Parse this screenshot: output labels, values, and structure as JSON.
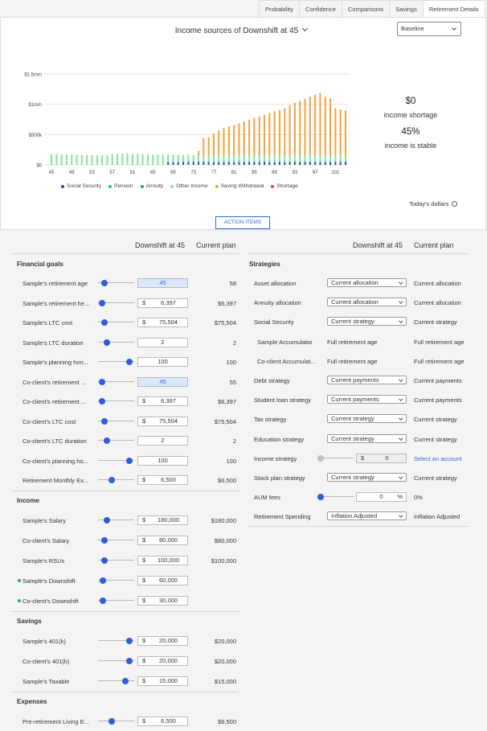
{
  "tabs": [
    "Probability",
    "Confidence",
    "Comparisons",
    "Savings",
    "Retirement Details"
  ],
  "chart": {
    "title": "Income sources of Downshift at 45",
    "scenario_select": "Baseline",
    "shortage_value": "$0",
    "shortage_label": "income shortage",
    "stable_value": "45%",
    "stable_label": "income is stable",
    "todays_dollars": "Today's dollars",
    "action_items": "ACTION ITEMS"
  },
  "chart_data": {
    "type": "bar",
    "stacked": true,
    "y_tick_labels": [
      "$0",
      "$500k",
      "$1mm",
      "$1.5mm"
    ],
    "ylim": [
      0,
      1500000
    ],
    "x_tick_labels": [
      "45",
      "49",
      "53",
      "57",
      "61",
      "65",
      "69",
      "73",
      "77",
      "81",
      "85",
      "89",
      "93",
      "97",
      "101"
    ],
    "x": [
      45,
      46,
      47,
      48,
      49,
      50,
      51,
      52,
      53,
      54,
      55,
      56,
      57,
      58,
      59,
      60,
      61,
      62,
      63,
      64,
      65,
      66,
      67,
      68,
      69,
      70,
      71,
      72,
      73,
      74,
      75,
      76,
      77,
      78,
      79,
      80,
      81,
      82,
      83,
      84,
      85,
      86,
      87,
      88,
      89,
      90,
      91,
      92,
      93,
      94,
      95,
      96,
      97,
      98,
      99,
      100,
      101,
      102,
      103
    ],
    "series": [
      {
        "name": "Social Security",
        "color": "#3b3fa8",
        "values": [
          0,
          0,
          0,
          0,
          0,
          0,
          0,
          0,
          0,
          0,
          0,
          0,
          0,
          0,
          0,
          0,
          0,
          0,
          0,
          0,
          0,
          0,
          0,
          40000,
          40000,
          40000,
          40000,
          40000,
          40000,
          40000,
          40000,
          40000,
          40000,
          40000,
          40000,
          40000,
          40000,
          40000,
          40000,
          40000,
          40000,
          40000,
          40000,
          40000,
          40000,
          40000,
          40000,
          40000,
          40000,
          40000,
          40000,
          40000,
          40000,
          40000,
          40000,
          40000,
          40000,
          40000,
          40000
        ]
      },
      {
        "name": "Pension",
        "color": "#26b5c9",
        "values": [
          0,
          0,
          0,
          0,
          0,
          0,
          0,
          0,
          0,
          0,
          0,
          0,
          0,
          0,
          0,
          0,
          0,
          0,
          0,
          0,
          0,
          0,
          0,
          20000,
          20000,
          20000,
          20000,
          20000,
          20000,
          20000,
          20000,
          20000,
          20000,
          20000,
          20000,
          20000,
          20000,
          20000,
          20000,
          20000,
          20000,
          20000,
          20000,
          20000,
          20000,
          20000,
          20000,
          20000,
          20000,
          20000,
          20000,
          20000,
          20000,
          20000,
          20000,
          20000,
          20000,
          20000,
          20000
        ]
      },
      {
        "name": "Annuity",
        "color": "#1ea58a",
        "values": [
          0,
          0,
          0,
          0,
          0,
          0,
          0,
          0,
          0,
          0,
          0,
          0,
          0,
          0,
          0,
          0,
          0,
          0,
          0,
          0,
          0,
          0,
          0,
          0,
          0,
          0,
          0,
          0,
          0,
          0,
          0,
          0,
          0,
          0,
          0,
          0,
          0,
          0,
          0,
          0,
          0,
          0,
          0,
          0,
          0,
          0,
          0,
          0,
          0,
          0,
          0,
          0,
          0,
          0,
          0,
          0,
          0,
          0,
          0
        ]
      },
      {
        "name": "Other Income",
        "color": "#86e39a",
        "values": [
          180000,
          180000,
          170000,
          170000,
          170000,
          165000,
          165000,
          160000,
          160000,
          160000,
          160000,
          160000,
          180000,
          180000,
          190000,
          190000,
          180000,
          180000,
          175000,
          175000,
          170000,
          170000,
          170000,
          110000,
          110000,
          110000,
          105000,
          105000,
          100000,
          100000,
          95000,
          95000,
          95000,
          95000,
          95000,
          95000,
          95000,
          95000,
          95000,
          95000,
          95000,
          95000,
          95000,
          95000,
          95000,
          95000,
          95000,
          95000,
          95000,
          95000,
          95000,
          95000,
          95000,
          95000,
          95000,
          95000,
          95000,
          95000,
          95000
        ]
      },
      {
        "name": "Saving Withdrawal",
        "color": "#f5a13c",
        "values": [
          0,
          0,
          0,
          0,
          0,
          0,
          0,
          0,
          0,
          0,
          0,
          0,
          0,
          0,
          0,
          0,
          0,
          0,
          0,
          0,
          0,
          0,
          0,
          0,
          0,
          0,
          0,
          0,
          0,
          70000,
          290000,
          300000,
          360000,
          410000,
          450000,
          480000,
          500000,
          530000,
          560000,
          590000,
          620000,
          640000,
          670000,
          700000,
          730000,
          750000,
          780000,
          830000,
          870000,
          900000,
          930000,
          970000,
          1000000,
          1030000,
          970000,
          940000,
          780000,
          760000,
          740000
        ]
      },
      {
        "name": "Shortage",
        "color": "#e0474c",
        "values": [
          0,
          0,
          0,
          0,
          0,
          0,
          0,
          0,
          0,
          0,
          0,
          0,
          0,
          0,
          0,
          0,
          0,
          0,
          0,
          0,
          0,
          0,
          0,
          0,
          0,
          0,
          0,
          0,
          0,
          0,
          0,
          0,
          0,
          0,
          0,
          0,
          0,
          0,
          0,
          0,
          0,
          0,
          0,
          0,
          0,
          0,
          0,
          0,
          0,
          0,
          0,
          0,
          0,
          0,
          0,
          0,
          0,
          0,
          0
        ]
      }
    ]
  },
  "columns": {
    "scenario": "Downshift at 45",
    "current": "Current plan"
  },
  "left": {
    "financial_goals": {
      "title": "Financial goals",
      "rows": [
        {
          "label": "Sample's retirement age",
          "value": "45",
          "current": "58"
        },
        {
          "label": "Sample's retirement he...",
          "prefix": "$",
          "value": "6,397",
          "current": "$6,397"
        },
        {
          "label": "Sample's LTC cost",
          "prefix": "$",
          "value": "75,504",
          "current": "$75,504"
        },
        {
          "label": "Sample's LTC duration",
          "value": "2",
          "current": "2"
        },
        {
          "label": "Sample's planning hori...",
          "value": "100",
          "current": "100"
        },
        {
          "label": "Co-client's retirement ...",
          "value": "45",
          "current": "55"
        },
        {
          "label": "Co-client's retirement ...",
          "prefix": "$",
          "value": "6,397",
          "current": "$6,397"
        },
        {
          "label": "Co-client's LTC cost",
          "prefix": "$",
          "value": "75,504",
          "current": "$75,504"
        },
        {
          "label": "Co-client's LTC duration",
          "value": "2",
          "current": "2"
        },
        {
          "label": "Co-client's planning ho...",
          "value": "100",
          "current": "100"
        },
        {
          "label": "Retirement Monthly Ex...",
          "prefix": "$",
          "value": "6,500",
          "current": "$6,500"
        }
      ]
    },
    "income": {
      "title": "Income",
      "rows": [
        {
          "label": "Sample's Salary",
          "prefix": "$",
          "value": "180,000",
          "current": "$180,000"
        },
        {
          "label": "Co-client's Salary",
          "prefix": "$",
          "value": "80,000",
          "current": "$80,000"
        },
        {
          "label": "Sample's RSUs",
          "prefix": "$",
          "value": "100,000",
          "current": "$100,000"
        },
        {
          "label": "Sample's Downshift",
          "prefix": "$",
          "value": "60,000",
          "current": ""
        },
        {
          "label": "Co-client's Downshift",
          "prefix": "$",
          "value": "30,000",
          "current": ""
        }
      ]
    },
    "savings": {
      "title": "Savings",
      "rows": [
        {
          "label": "Sample's 401(k)",
          "prefix": "$",
          "value": "20,000",
          "current": "$20,000"
        },
        {
          "label": "Co-client's 401(k)",
          "prefix": "$",
          "value": "20,000",
          "current": "$20,000"
        },
        {
          "label": "Sample's Taxable",
          "prefix": "$",
          "value": "15,000",
          "current": "$15,000"
        }
      ]
    },
    "expenses": {
      "title": "Expenses",
      "rows": [
        {
          "label": "Pre-retirement Living E...",
          "prefix": "$",
          "value": "6,500",
          "current": "$6,500"
        }
      ]
    }
  },
  "strategies": {
    "title": "Strategies",
    "rows": [
      {
        "label": "Asset allocation",
        "select": "Current allocation",
        "current": "Current allocation"
      },
      {
        "label": "Annuity allocation",
        "select": "Current allocation",
        "current": "Current allocation"
      },
      {
        "label": "Social Security",
        "select": "Current strategy",
        "current": "Current strategy"
      },
      {
        "label": "Sample Accumulator",
        "text": "Full retirement age",
        "current": "Full retirement age"
      },
      {
        "label": "Co-client Accumulat...",
        "text": "Full retirement age",
        "current": "Full retirement age"
      },
      {
        "label": "Debt strategy",
        "select": "Current payments",
        "current": "Current payments"
      },
      {
        "label": "Student loan strategy",
        "select": "Current payments",
        "current": "Current payments"
      },
      {
        "label": "Tax strategy",
        "select": "Current strategy",
        "current": "Current strategy"
      },
      {
        "label": "Education strategy",
        "select": "Current strategy",
        "current": "Current strategy"
      },
      {
        "label": "Income strategy",
        "prefix": "$",
        "value": "0",
        "current": "Select an account"
      },
      {
        "label": "Stock plan strategy",
        "select": "Current strategy",
        "current": "Current strategy"
      },
      {
        "label": "AUM fees",
        "value": "0",
        "suffix": "%",
        "current": "0%"
      },
      {
        "label": "Retirement Spending",
        "select": "Inflation Adjusted",
        "current": "Inflation Adjusted"
      }
    ]
  }
}
